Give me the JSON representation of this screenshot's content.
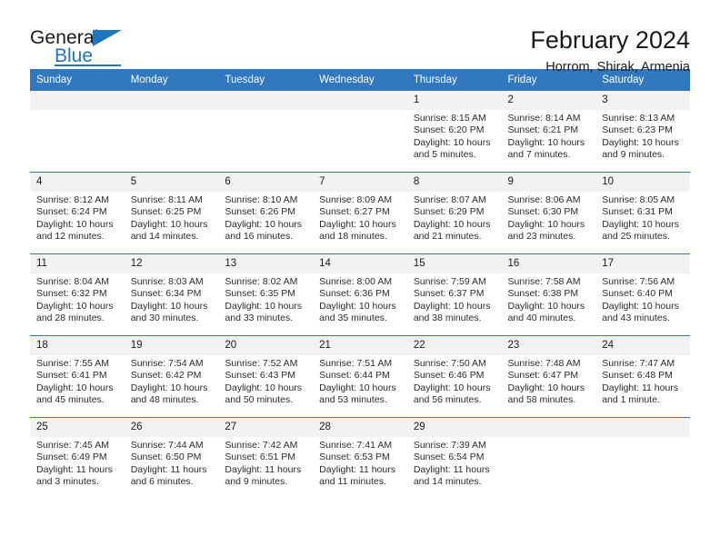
{
  "brand": {
    "line1": "General",
    "line2": "Blue",
    "accent_color": "#1f76bc",
    "triangle_icon": "brand-triangle-icon"
  },
  "header": {
    "title": "February 2024",
    "subtitle": "Horrom, Shirak, Armenia"
  },
  "calendar": {
    "header_bg": "#3278be",
    "daynum_bg": "#f2f2f2",
    "weekdays": [
      "Sunday",
      "Monday",
      "Tuesday",
      "Wednesday",
      "Thursday",
      "Friday",
      "Saturday"
    ],
    "weeks": [
      [
        {
          "day": "",
          "sunrise": "",
          "sunset": "",
          "daylight": ""
        },
        {
          "day": "",
          "sunrise": "",
          "sunset": "",
          "daylight": ""
        },
        {
          "day": "",
          "sunrise": "",
          "sunset": "",
          "daylight": ""
        },
        {
          "day": "",
          "sunrise": "",
          "sunset": "",
          "daylight": ""
        },
        {
          "day": "1",
          "sunrise": "Sunrise: 8:15 AM",
          "sunset": "Sunset: 6:20 PM",
          "daylight": "Daylight: 10 hours and 5 minutes."
        },
        {
          "day": "2",
          "sunrise": "Sunrise: 8:14 AM",
          "sunset": "Sunset: 6:21 PM",
          "daylight": "Daylight: 10 hours and 7 minutes."
        },
        {
          "day": "3",
          "sunrise": "Sunrise: 8:13 AM",
          "sunset": "Sunset: 6:23 PM",
          "daylight": "Daylight: 10 hours and 9 minutes."
        }
      ],
      [
        {
          "day": "4",
          "sunrise": "Sunrise: 8:12 AM",
          "sunset": "Sunset: 6:24 PM",
          "daylight": "Daylight: 10 hours and 12 minutes."
        },
        {
          "day": "5",
          "sunrise": "Sunrise: 8:11 AM",
          "sunset": "Sunset: 6:25 PM",
          "daylight": "Daylight: 10 hours and 14 minutes."
        },
        {
          "day": "6",
          "sunrise": "Sunrise: 8:10 AM",
          "sunset": "Sunset: 6:26 PM",
          "daylight": "Daylight: 10 hours and 16 minutes."
        },
        {
          "day": "7",
          "sunrise": "Sunrise: 8:09 AM",
          "sunset": "Sunset: 6:27 PM",
          "daylight": "Daylight: 10 hours and 18 minutes."
        },
        {
          "day": "8",
          "sunrise": "Sunrise: 8:07 AM",
          "sunset": "Sunset: 6:29 PM",
          "daylight": "Daylight: 10 hours and 21 minutes."
        },
        {
          "day": "9",
          "sunrise": "Sunrise: 8:06 AM",
          "sunset": "Sunset: 6:30 PM",
          "daylight": "Daylight: 10 hours and 23 minutes."
        },
        {
          "day": "10",
          "sunrise": "Sunrise: 8:05 AM",
          "sunset": "Sunset: 6:31 PM",
          "daylight": "Daylight: 10 hours and 25 minutes."
        }
      ],
      [
        {
          "day": "11",
          "sunrise": "Sunrise: 8:04 AM",
          "sunset": "Sunset: 6:32 PM",
          "daylight": "Daylight: 10 hours and 28 minutes."
        },
        {
          "day": "12",
          "sunrise": "Sunrise: 8:03 AM",
          "sunset": "Sunset: 6:34 PM",
          "daylight": "Daylight: 10 hours and 30 minutes."
        },
        {
          "day": "13",
          "sunrise": "Sunrise: 8:02 AM",
          "sunset": "Sunset: 6:35 PM",
          "daylight": "Daylight: 10 hours and 33 minutes."
        },
        {
          "day": "14",
          "sunrise": "Sunrise: 8:00 AM",
          "sunset": "Sunset: 6:36 PM",
          "daylight": "Daylight: 10 hours and 35 minutes."
        },
        {
          "day": "15",
          "sunrise": "Sunrise: 7:59 AM",
          "sunset": "Sunset: 6:37 PM",
          "daylight": "Daylight: 10 hours and 38 minutes."
        },
        {
          "day": "16",
          "sunrise": "Sunrise: 7:58 AM",
          "sunset": "Sunset: 6:38 PM",
          "daylight": "Daylight: 10 hours and 40 minutes."
        },
        {
          "day": "17",
          "sunrise": "Sunrise: 7:56 AM",
          "sunset": "Sunset: 6:40 PM",
          "daylight": "Daylight: 10 hours and 43 minutes."
        }
      ],
      [
        {
          "day": "18",
          "sunrise": "Sunrise: 7:55 AM",
          "sunset": "Sunset: 6:41 PM",
          "daylight": "Daylight: 10 hours and 45 minutes."
        },
        {
          "day": "19",
          "sunrise": "Sunrise: 7:54 AM",
          "sunset": "Sunset: 6:42 PM",
          "daylight": "Daylight: 10 hours and 48 minutes."
        },
        {
          "day": "20",
          "sunrise": "Sunrise: 7:52 AM",
          "sunset": "Sunset: 6:43 PM",
          "daylight": "Daylight: 10 hours and 50 minutes."
        },
        {
          "day": "21",
          "sunrise": "Sunrise: 7:51 AM",
          "sunset": "Sunset: 6:44 PM",
          "daylight": "Daylight: 10 hours and 53 minutes."
        },
        {
          "day": "22",
          "sunrise": "Sunrise: 7:50 AM",
          "sunset": "Sunset: 6:46 PM",
          "daylight": "Daylight: 10 hours and 56 minutes."
        },
        {
          "day": "23",
          "sunrise": "Sunrise: 7:48 AM",
          "sunset": "Sunset: 6:47 PM",
          "daylight": "Daylight: 10 hours and 58 minutes."
        },
        {
          "day": "24",
          "sunrise": "Sunrise: 7:47 AM",
          "sunset": "Sunset: 6:48 PM",
          "daylight": "Daylight: 11 hours and 1 minute."
        }
      ],
      [
        {
          "day": "25",
          "sunrise": "Sunrise: 7:45 AM",
          "sunset": "Sunset: 6:49 PM",
          "daylight": "Daylight: 11 hours and 3 minutes."
        },
        {
          "day": "26",
          "sunrise": "Sunrise: 7:44 AM",
          "sunset": "Sunset: 6:50 PM",
          "daylight": "Daylight: 11 hours and 6 minutes."
        },
        {
          "day": "27",
          "sunrise": "Sunrise: 7:42 AM",
          "sunset": "Sunset: 6:51 PM",
          "daylight": "Daylight: 11 hours and 9 minutes."
        },
        {
          "day": "28",
          "sunrise": "Sunrise: 7:41 AM",
          "sunset": "Sunset: 6:53 PM",
          "daylight": "Daylight: 11 hours and 11 minutes."
        },
        {
          "day": "29",
          "sunrise": "Sunrise: 7:39 AM",
          "sunset": "Sunset: 6:54 PM",
          "daylight": "Daylight: 11 hours and 14 minutes."
        },
        {
          "day": "",
          "sunrise": "",
          "sunset": "",
          "daylight": ""
        },
        {
          "day": "",
          "sunrise": "",
          "sunset": "",
          "daylight": ""
        }
      ]
    ]
  }
}
